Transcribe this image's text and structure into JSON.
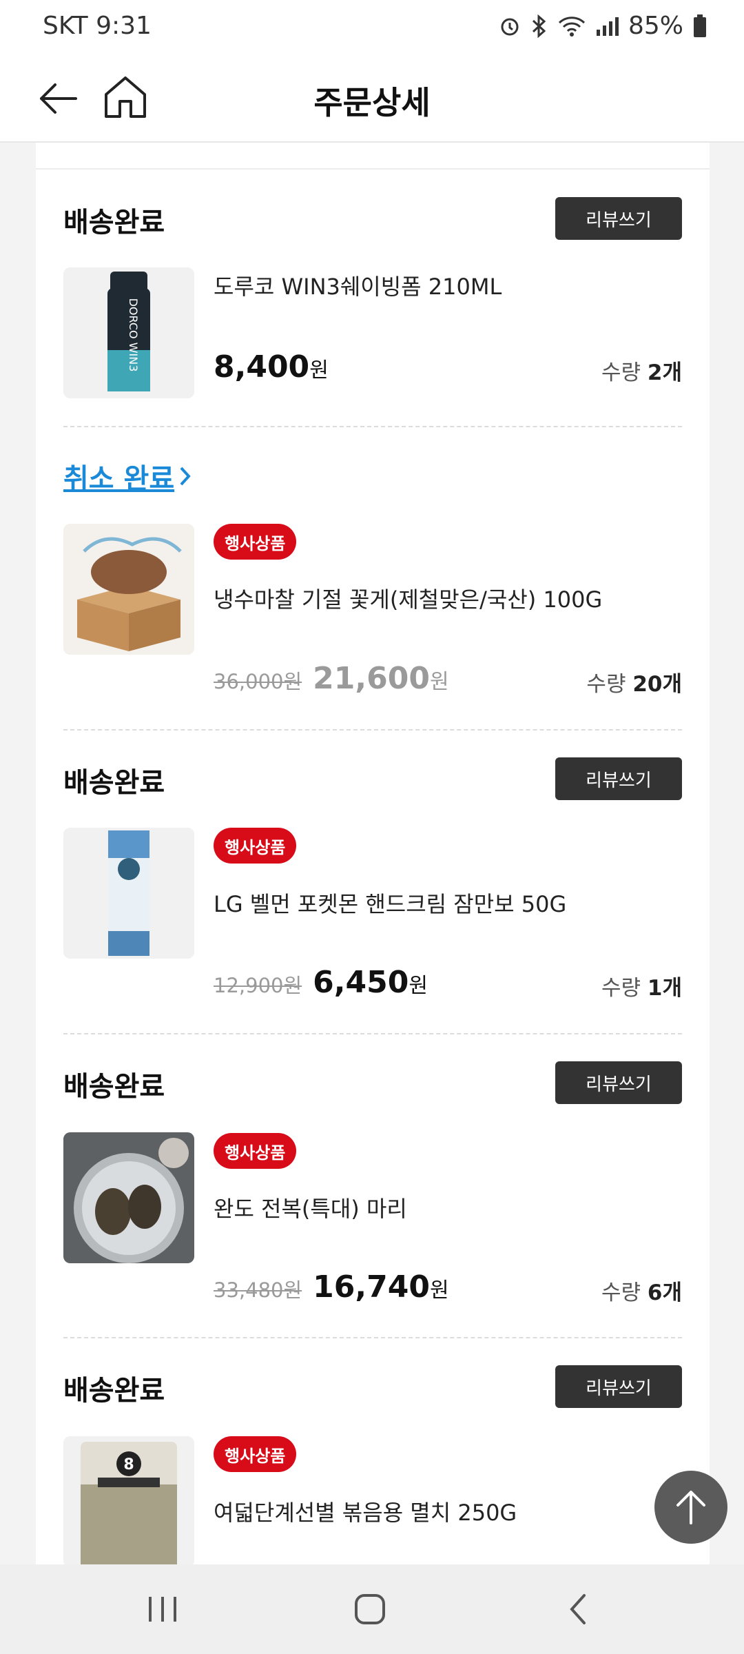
{
  "status_bar": {
    "carrier_time": "SKT 9:31",
    "battery": "85%"
  },
  "header": {
    "title": "주문상세",
    "back_icon": "arrow-left-icon",
    "home_icon": "home-icon"
  },
  "items": [
    {
      "status": "배송완료",
      "review_label": "리뷰쓰기",
      "badge": "",
      "name": "도루코 WIN3쉐이빙폼 210ML",
      "original_price": "",
      "price": "8,400",
      "currency": "원",
      "qty_label": "수량",
      "qty": "2개"
    },
    {
      "status": "취소 완료",
      "review_label": "",
      "badge": "행사상품",
      "name": "냉수마찰 기절 꽃게(제철맞은/국산) 100G",
      "original_price": "36,000원",
      "price": "21,600",
      "currency": "원",
      "qty_label": "수량",
      "qty": "20개"
    },
    {
      "status": "배송완료",
      "review_label": "리뷰쓰기",
      "badge": "행사상품",
      "name": "LG 벨먼 포켓몬 핸드크림 잠만보 50G",
      "original_price": "12,900원",
      "price": "6,450",
      "currency": "원",
      "qty_label": "수량",
      "qty": "1개"
    },
    {
      "status": "배송완료",
      "review_label": "리뷰쓰기",
      "badge": "행사상품",
      "name": "완도 전복(특대) 마리",
      "original_price": "33,480원",
      "price": "16,740",
      "currency": "원",
      "qty_label": "수량",
      "qty": "6개"
    },
    {
      "status": "배송완료",
      "review_label": "리뷰쓰기",
      "badge": "행사상품",
      "name": "여덟단계선별 볶음용 멸치 250G",
      "original_price": "",
      "price": "",
      "currency": "",
      "qty_label": "",
      "qty": ""
    }
  ],
  "colors": {
    "accent_red": "#d80c18",
    "link_blue": "#1a8ad8",
    "button_dark": "#333333"
  }
}
